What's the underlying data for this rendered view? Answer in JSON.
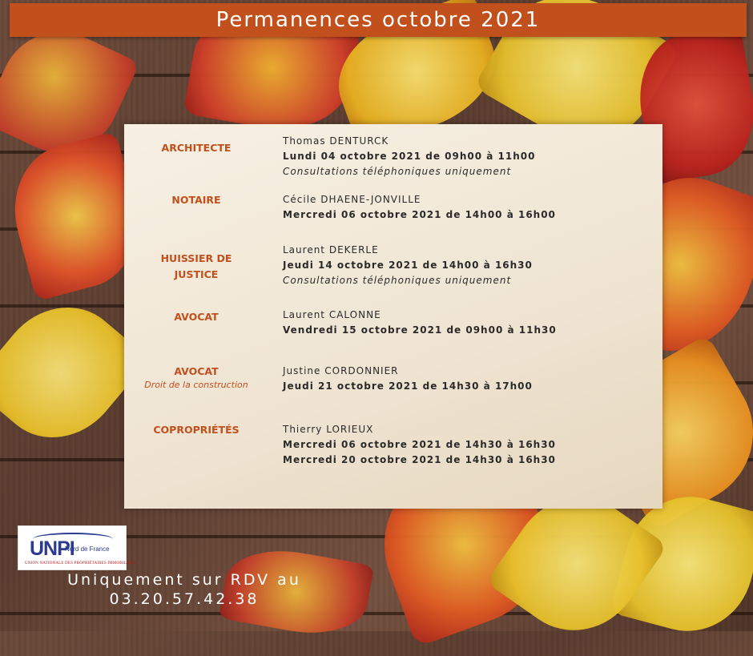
{
  "header": {
    "title": "Permanences octobre 2021"
  },
  "entries": [
    {
      "role": "ARCHITECTE",
      "role_sub": "",
      "name": "Thomas DENTURCK",
      "dates": [
        "Lundi 04 octobre 2021 de 09h00 à 11h00"
      ],
      "note": "Consultations téléphoniques uniquement"
    },
    {
      "role": "NOTAIRE",
      "role_sub": "",
      "name": "Cécile DHAENE-JONVILLE",
      "dates": [
        "Mercredi 06 octobre 2021 de 14h00 à 16h00"
      ],
      "note": ""
    },
    {
      "role": "HUISSIER DE JUSTICE",
      "role_sub": "",
      "name": "Laurent DEKERLE",
      "dates": [
        "Jeudi 14 octobre 2021 de 14h00 à 16h30"
      ],
      "note": "Consultations téléphoniques uniquement"
    },
    {
      "role": "AVOCAT",
      "role_sub": "",
      "name": "Laurent CALONNE",
      "dates": [
        "Vendredi 15 octobre 2021 de 09h00 à 11h30"
      ],
      "note": ""
    },
    {
      "role": "AVOCAT",
      "role_sub": "Droit de la construction",
      "name": "Justine CORDONNIER",
      "dates": [
        "Jeudi 21 octobre 2021 de 14h30 à 17h00"
      ],
      "note": ""
    },
    {
      "role": "COPROPRIÉTÉS",
      "role_sub": "",
      "name": "Thierry LORIEUX",
      "dates": [
        "Mercredi 06 octobre 2021 de 14h30 à 16h30",
        "Mercredi 20 octobre 2021 de 14h30 à 16h30"
      ],
      "note": ""
    }
  ],
  "logo": {
    "mark": "UNPI",
    "sub": "Nord de France",
    "bottom": "UNION NATIONALE DES PROPRIÉTAIRES IMMOBILIERS"
  },
  "footer": {
    "line1": "Uniquement sur RDV au",
    "line2": "03.20.57.42.38"
  },
  "colors": {
    "accent": "#c2501c",
    "card": "#f3ead9",
    "text": "#2a2a2a"
  }
}
